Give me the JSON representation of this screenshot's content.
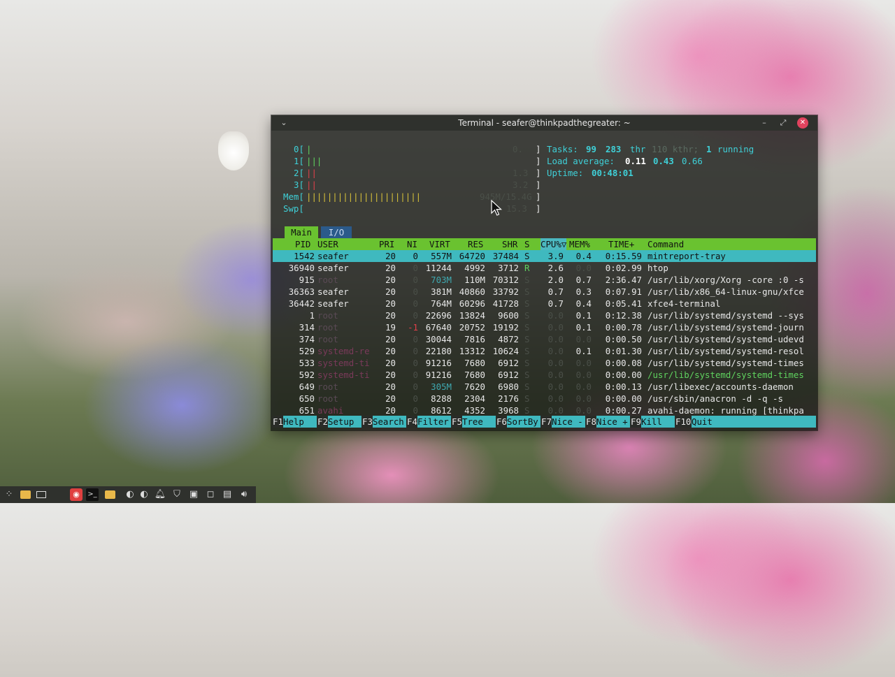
{
  "window": {
    "title": "Terminal - seafer@thinkpadthegreater: ~"
  },
  "icons": {
    "window_menu": "chevron-down-icon",
    "minimize": "minimize-icon",
    "maximize": "maximize-icon",
    "close": "close-icon"
  },
  "meters": {
    "cpu0": {
      "label": "0[",
      "bar": "|",
      "value": "0.",
      "close": "]"
    },
    "cpu1": {
      "label": "1[",
      "bar": "|||",
      "value": "",
      "close": "]"
    },
    "cpu2": {
      "label": "2[",
      "bar": "||",
      "value": "1.3",
      "close": "]"
    },
    "cpu3": {
      "label": "3[",
      "bar": "||",
      "value": "3.2",
      "close": "]"
    },
    "mem": {
      "label": "Mem[",
      "bar": "||||||||||||||||||||||",
      "value": "945M/15.4G",
      "close": "]"
    },
    "swp": {
      "label": "Swp[",
      "bar": "",
      "value": "15.3",
      "close": "]"
    }
  },
  "stats": {
    "tasks_label": "Tasks:",
    "tasks": "99",
    "threads": "283",
    "threads_label": "thr",
    "kthr": "110 kthr;",
    "running": "1",
    "running_label": "running",
    "load_label": "Load average:",
    "load1": "0.11",
    "load5": "0.43",
    "load15": "0.66",
    "uptime_label": "Uptime:",
    "uptime": "00:48:01"
  },
  "tabs": {
    "main": "Main",
    "io": "I/O"
  },
  "columns": {
    "pid": "PID",
    "user": "USER",
    "pri": "PRI",
    "ni": "NI",
    "virt": "VIRT",
    "res": "RES",
    "shr": "SHR",
    "s": "S",
    "cpu": "CPU%▽",
    "mem": "MEM%",
    "time": "TIME+",
    "command": "Command"
  },
  "processes": [
    {
      "pid": "1542",
      "user": "seafer",
      "pri": "20",
      "ni": "0",
      "virt": "557M",
      "res": "64720",
      "shr": "37484",
      "s": "S",
      "cpu": "3.9",
      "mem": "0.4",
      "time": "0:15.59",
      "command": "mintreport-tray"
    },
    {
      "pid": "36940",
      "user": "seafer",
      "pri": "20",
      "ni": "0",
      "virt": "11244",
      "res": "4992",
      "shr": "3712",
      "s": "R",
      "cpu": "2.6",
      "mem": "0.0",
      "time": "0:02.99",
      "command": "htop"
    },
    {
      "pid": "915",
      "user": "root",
      "pri": "20",
      "ni": "0",
      "virt": "703M",
      "res": "110M",
      "shr": "70312",
      "s": "S",
      "cpu": "2.0",
      "mem": "0.7",
      "time": "2:36.47",
      "command": "/usr/lib/xorg/Xorg -core :0 -s"
    },
    {
      "pid": "36363",
      "user": "seafer",
      "pri": "20",
      "ni": "0",
      "virt": "381M",
      "res": "40860",
      "shr": "33792",
      "s": "S",
      "cpu": "0.7",
      "mem": "0.3",
      "time": "0:07.91",
      "command": "/usr/lib/x86_64-linux-gnu/xfce"
    },
    {
      "pid": "36442",
      "user": "seafer",
      "pri": "20",
      "ni": "0",
      "virt": "764M",
      "res": "60296",
      "shr": "41728",
      "s": "S",
      "cpu": "0.7",
      "mem": "0.4",
      "time": "0:05.41",
      "command": "xfce4-terminal"
    },
    {
      "pid": "1",
      "user": "root",
      "pri": "20",
      "ni": "0",
      "virt": "22696",
      "res": "13824",
      "shr": "9600",
      "s": "S",
      "cpu": "0.0",
      "mem": "0.1",
      "time": "0:12.38",
      "command": "/usr/lib/systemd/systemd --sys"
    },
    {
      "pid": "314",
      "user": "root",
      "pri": "19",
      "ni": "-1",
      "virt": "67640",
      "res": "20752",
      "shr": "19192",
      "s": "S",
      "cpu": "0.0",
      "mem": "0.1",
      "time": "0:00.78",
      "command": "/usr/lib/systemd/systemd-journ"
    },
    {
      "pid": "374",
      "user": "root",
      "pri": "20",
      "ni": "0",
      "virt": "30044",
      "res": "7816",
      "shr": "4872",
      "s": "S",
      "cpu": "0.0",
      "mem": "0.0",
      "time": "0:00.50",
      "command": "/usr/lib/systemd/systemd-udevd"
    },
    {
      "pid": "529",
      "user": "systemd-re",
      "pri": "20",
      "ni": "0",
      "virt": "22180",
      "res": "13312",
      "shr": "10624",
      "s": "S",
      "cpu": "0.0",
      "mem": "0.1",
      "time": "0:01.30",
      "command": "/usr/lib/systemd/systemd-resol"
    },
    {
      "pid": "533",
      "user": "systemd-ti",
      "pri": "20",
      "ni": "0",
      "virt": "91216",
      "res": "7680",
      "shr": "6912",
      "s": "S",
      "cpu": "0.0",
      "mem": "0.0",
      "time": "0:00.08",
      "command": "/usr/lib/systemd/systemd-times"
    },
    {
      "pid": "592",
      "user": "systemd-ti",
      "pri": "20",
      "ni": "0",
      "virt": "91216",
      "res": "7680",
      "shr": "6912",
      "s": "S",
      "cpu": "0.0",
      "mem": "0.0",
      "time": "0:00.00",
      "command": "/usr/lib/systemd/systemd-times"
    },
    {
      "pid": "649",
      "user": "root",
      "pri": "20",
      "ni": "0",
      "virt": "305M",
      "res": "7620",
      "shr": "6980",
      "s": "S",
      "cpu": "0.0",
      "mem": "0.0",
      "time": "0:00.13",
      "command": "/usr/libexec/accounts-daemon"
    },
    {
      "pid": "650",
      "user": "root",
      "pri": "20",
      "ni": "0",
      "virt": "8288",
      "res": "2304",
      "shr": "2176",
      "s": "S",
      "cpu": "0.0",
      "mem": "0.0",
      "time": "0:00.00",
      "command": "/usr/sbin/anacron -d -q -s"
    },
    {
      "pid": "651",
      "user": "avahi",
      "pri": "20",
      "ni": "0",
      "virt": "8612",
      "res": "4352",
      "shr": "3968",
      "s": "S",
      "cpu": "0.0",
      "mem": "0.0",
      "time": "0:00.27",
      "command": "avahi-daemon: running [thinkpa"
    }
  ],
  "footer": [
    {
      "key": "F1",
      "label": "Help"
    },
    {
      "key": "F2",
      "label": "Setup"
    },
    {
      "key": "F3",
      "label": "Search"
    },
    {
      "key": "F4",
      "label": "Filter"
    },
    {
      "key": "F5",
      "label": "Tree"
    },
    {
      "key": "F6",
      "label": "SortBy"
    },
    {
      "key": "F7",
      "label": "Nice -"
    },
    {
      "key": "F8",
      "label": "Nice +"
    },
    {
      "key": "F9",
      "label": "Kill"
    },
    {
      "key": "F10",
      "label": "Quit"
    }
  ],
  "taskbar_icons": [
    "app-menu-icon",
    "folder-icon",
    "window-icon",
    "terminal-app-icon",
    "terminal-icon",
    "files-icon",
    "network-icon",
    "audio-icon",
    "notification-icon",
    "shield-icon",
    "clipboard-icon",
    "window-list-icon",
    "paste-icon",
    "volume-icon"
  ]
}
